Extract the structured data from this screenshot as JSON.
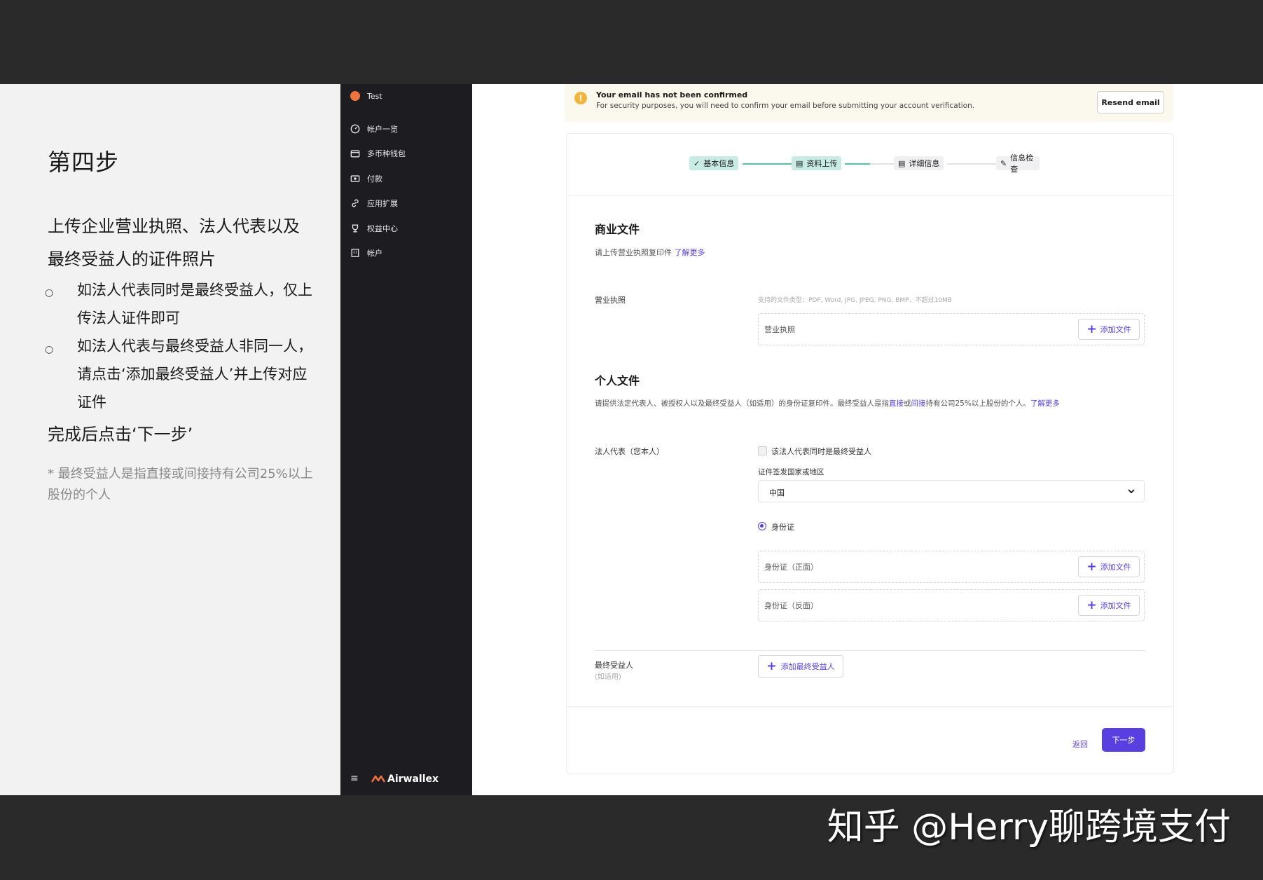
{
  "slide": {
    "step_title": "第四步",
    "main_desc": "上传企业营业执照、法人代表以及最终受益人的证件照片",
    "bullet1": "如法人代表同时是最终受益人，仅上传法人证件即可",
    "bullet2": "如法人代表与最终受益人非同一人，请点击‘添加最终受益人’并上传对应证件",
    "done_text": "完成后点击‘下一步’",
    "footnote": "* 最终受益人是指直接或间接持有公司25%以上股份的个人"
  },
  "sidebar": {
    "org_name": "Test",
    "items": [
      {
        "label": "帐户一览",
        "icon": "dashboard-icon"
      },
      {
        "label": "多币种钱包",
        "icon": "wallet-icon"
      },
      {
        "label": "付款",
        "icon": "payment-icon"
      },
      {
        "label": "应用扩展",
        "icon": "link-icon"
      },
      {
        "label": "权益中心",
        "icon": "trophy-icon"
      },
      {
        "label": "帐户",
        "icon": "building-icon"
      }
    ],
    "menu_icon": "≡",
    "brand": "Airwallex"
  },
  "alert": {
    "title": "Your email has not been confirmed",
    "subtitle": "For security purposes, you will need to confirm your email before submitting your account verification.",
    "resend_label": "Resend email"
  },
  "stepper": {
    "steps": [
      {
        "label": "基本信息",
        "state": "done"
      },
      {
        "label": "资料上传",
        "state": "current"
      },
      {
        "label": "详细信息",
        "state": "todo"
      },
      {
        "label": "信息检查",
        "state": "todo"
      }
    ]
  },
  "business": {
    "title": "商业文件",
    "desc": "请上传营业执照复印件",
    "learn_more": "了解更多",
    "license_label": "营业执照",
    "file_types_hint": "支持的文件类型：PDF, Word, JPG, JPEG, PNG, BMP，不超过10MB",
    "upload_placeholder": "营业执照",
    "add_file_label": "添加文件"
  },
  "personal": {
    "title": "个人文件",
    "desc_part1": "请提供法定代表人、被授权人以及最终受益人（如适用）的身份证复印件。最终受益人是指",
    "direct": "直接",
    "or": "或",
    "indirect": "间接",
    "desc_part2": "持有公司25%以上股份的个人。",
    "learn_more": "了解更多",
    "legal_rep_label": "法人代表（您本人）",
    "is_ubo_checkbox": "该法人代表同时是最终受益人",
    "country_label": "证件签发国家或地区",
    "country_value": "中国",
    "id_type": "身份证",
    "id_front": "身份证（正面）",
    "id_back": "身份证（反面）",
    "add_file_label": "添加文件",
    "ubo_label": "最终受益人",
    "ubo_sub": "(如适用)",
    "add_ubo_label": "添加最终受益人"
  },
  "footer": {
    "back_label": "返回",
    "next_label": "下一步"
  },
  "watermark": "知乎 @Herry聊跨境支付",
  "colors": {
    "accent": "#5a3fe0",
    "sidebar_bg": "#1d1d21",
    "step_done": "#c8ece3",
    "alert_bg": "#fbf8ee"
  }
}
